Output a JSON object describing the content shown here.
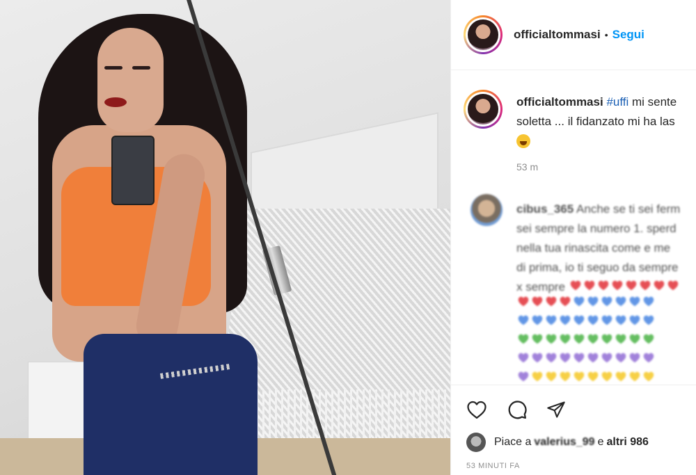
{
  "post": {
    "username": "officialtommasi",
    "separator": "•",
    "follow_label": "Segui"
  },
  "caption": {
    "username": "officialtommasi",
    "hashtag": "#uffi",
    "line1_rest": " mi sente",
    "line2": "soletta ... il fidanzato mi ha las",
    "time": "53 m"
  },
  "comment": {
    "username": "cibus_365",
    "line1": " Anche se ti sei ferm",
    "line2": "sei sempre la numero 1. sperd",
    "line3": "nella tua rinascita come e me",
    "line4": "di prima, io ti seguo da sempre",
    "line5": "x sempre",
    "heart_rows": [
      [
        "#e0242b",
        "#e0242b",
        "#e0242b",
        "#e0242b",
        "#e0242b",
        "#e0242b",
        "#e0242b",
        "#e0242b"
      ],
      [
        "#e0242b",
        "#e0242b",
        "#e0242b",
        "#e0242b",
        "#3b7de0",
        "#3b7de0",
        "#3b7de0",
        "#3b7de0",
        "#3b7de0",
        "#3b7de0"
      ],
      [
        "#3b7de0",
        "#3b7de0",
        "#3b7de0",
        "#3b7de0",
        "#3b7de0",
        "#3b7de0",
        "#3b7de0",
        "#3b7de0",
        "#3b7de0",
        "#3b7de0"
      ],
      [
        "#3fae3a",
        "#3fae3a",
        "#3fae3a",
        "#3fae3a",
        "#3fae3a",
        "#3fae3a",
        "#3fae3a",
        "#3fae3a",
        "#3fae3a",
        "#3fae3a"
      ],
      [
        "#8a63d2",
        "#8a63d2",
        "#8a63d2",
        "#8a63d2",
        "#8a63d2",
        "#8a63d2",
        "#8a63d2",
        "#8a63d2",
        "#8a63d2",
        "#8a63d2"
      ],
      [
        "#8a63d2",
        "#f5c518",
        "#f5c518",
        "#f5c518",
        "#f5c518",
        "#f5c518",
        "#f5c518",
        "#f5c518",
        "#f5c518",
        "#f5c518"
      ]
    ]
  },
  "actions": {
    "icons": [
      "heart-icon",
      "comment-icon",
      "share-icon"
    ]
  },
  "likes": {
    "prefix": "Piace a",
    "liker": "valerius_99",
    "middle": "e",
    "others": "altri 986"
  },
  "timestamp": "53 MINUTI FA",
  "colors": {
    "follow": "#0095f6",
    "secondary_text": "#8e8e8e",
    "hashtag": "#1a5fb4"
  }
}
